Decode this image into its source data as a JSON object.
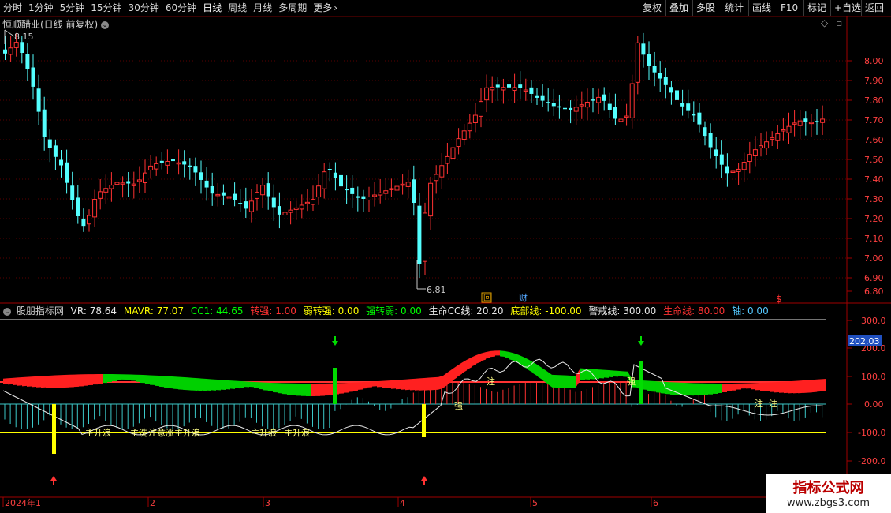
{
  "toolbar": {
    "periods": [
      "分时",
      "1分钟",
      "5分钟",
      "15分钟",
      "30分钟",
      "60分钟",
      "日线",
      "周线",
      "月线",
      "多周期",
      "更多"
    ],
    "right_buttons": [
      "复权",
      "叠加",
      "多股",
      "统计",
      "画线",
      "F10",
      "标记",
      "+自选",
      "返回"
    ]
  },
  "main_panel": {
    "title": "恒顺醋业(日线 前复权)",
    "high_label": "8.15",
    "low_label": "6.81",
    "price_axis": [
      "8.00",
      "7.90",
      "7.80",
      "7.70",
      "7.60",
      "7.50",
      "7.40",
      "7.30",
      "7.20",
      "7.10",
      "7.00",
      "6.90",
      "6.80"
    ],
    "markers": [
      "回",
      "财",
      "$"
    ]
  },
  "indicator": {
    "name": "股朋指标网",
    "vr": "VR: 78.64",
    "mavr": "MAVR: 77.07",
    "cc1": "CC1: 44.65",
    "zhuanqiang": "转强: 1.00",
    "ruozhuanqiang": "弱转强: 0.00",
    "qiangzhuanruo": "强转弱: 0.00",
    "shengming_cc": "生命CC线: 20.20",
    "dibu": "底部线: -100.00",
    "jingjie": "警戒线: 300.00",
    "shengming": "生命线: 80.00",
    "zhou": "轴: 0.00",
    "axis": [
      "300.0",
      "200.0",
      "100.0",
      "0.00",
      "-100.0",
      "-200.0"
    ],
    "current_value": "202.03",
    "annotations": [
      "主升浪",
      "主洗 ",
      "注意",
      "涨主升浪",
      "主升浪",
      "主升浪",
      "主升浪",
      "注",
      "强",
      "强",
      "注",
      "注"
    ]
  },
  "time_axis": [
    "2024年1",
    "2",
    "3",
    "4",
    "5",
    "6"
  ],
  "watermark": {
    "line1": "指标公式网",
    "line2": "www.zbgs3.com"
  },
  "colors": {
    "up": "#ff3232",
    "down": "#54ffff",
    "bg": "#000000",
    "grid": "#5a0000",
    "yellow": "#ffff00",
    "green": "#00dd00"
  }
}
